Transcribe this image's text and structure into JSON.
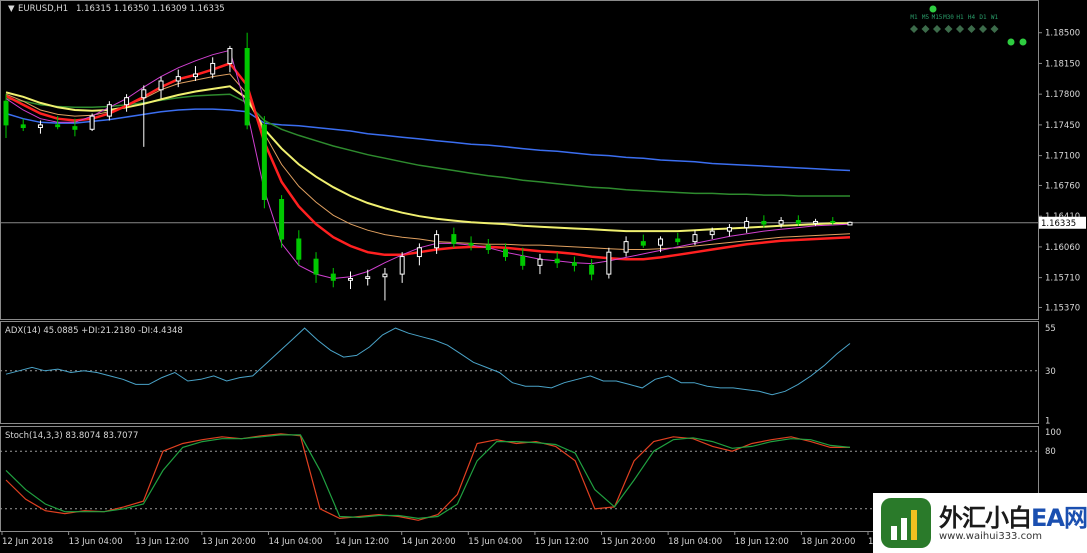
{
  "chart_data": [
    {
      "type": "candlestick",
      "symbol_header": "EURUSD,H1",
      "ohlc_header": "1.16315 1.16350 1.16309 1.16335",
      "current_price_label": "1.16335",
      "current_price": 1.16335,
      "ylim": [
        1.1525,
        1.1885
      ],
      "y_ticks": [
        "1.18500",
        "1.18150",
        "1.17800",
        "1.17450",
        "1.17100",
        "1.16760",
        "1.16410",
        "1.16060",
        "1.15710",
        "1.15370"
      ],
      "y_tick_values": [
        1.185,
        1.1815,
        1.178,
        1.1745,
        1.171,
        1.1676,
        1.1641,
        1.1606,
        1.1571,
        1.1537
      ],
      "x_labels": [
        "12 Jun 2018",
        "13 Jun 04:00",
        "13 Jun 12:00",
        "13 Jun 20:00",
        "14 Jun 04:00",
        "14 Jun 12:00",
        "14 Jun 20:00",
        "15 Jun 04:00",
        "15 Jun 12:00",
        "15 Jun 20:00",
        "18 Jun 04:00",
        "18 Jun 12:00",
        "18 Jun 20:00",
        "19 Jun 04:00"
      ],
      "timeframes": [
        "M1",
        "M5",
        "M15",
        "M30",
        "H1",
        "H4",
        "D1",
        "W1"
      ],
      "colors": {
        "up_candle": "#ffffff",
        "down_candle": "#00c800",
        "ma_blue": "#3b6ef0",
        "ma_green": "#2e8b2e",
        "ma_yellow": "#f0f070",
        "ma_orange": "#e0a060",
        "ma_red": "#ff2020",
        "ma_magenta": "#d040d0",
        "grid_line": "#888888"
      },
      "series": [
        {
          "values": [
            1.1758,
            1.1752,
            1.1748,
            1.1747,
            1.1747,
            1.1749,
            1.1751,
            1.1754,
            1.1757,
            1.176,
            1.1762,
            1.1763,
            1.1763,
            1.1762,
            1.176,
            1.1747,
            1.1745,
            1.1744,
            1.1742,
            1.174,
            1.1738,
            1.1735,
            1.1733,
            1.1731,
            1.1729,
            1.1727,
            1.1725,
            1.1723,
            1.1722,
            1.172,
            1.1718,
            1.1716,
            1.1715,
            1.1713,
            1.1711,
            1.171,
            1.1708,
            1.1707,
            1.1705,
            1.1704,
            1.1703,
            1.1701,
            1.17,
            1.1699,
            1.1698,
            1.1697,
            1.1696,
            1.1695,
            1.1694,
            1.1693
          ]
        },
        {
          "values": [
            1.1775,
            1.1772,
            1.1768,
            1.1766,
            1.1765,
            1.1765,
            1.1766,
            1.1768,
            1.177,
            1.1773,
            1.1776,
            1.1778,
            1.1779,
            1.178,
            1.177,
            1.175,
            1.174,
            1.1733,
            1.1727,
            1.1721,
            1.1716,
            1.1711,
            1.1707,
            1.1703,
            1.1699,
            1.1696,
            1.1693,
            1.169,
            1.1687,
            1.1685,
            1.1682,
            1.168,
            1.1678,
            1.1676,
            1.1674,
            1.1673,
            1.1671,
            1.167,
            1.1669,
            1.1668,
            1.1667,
            1.1667,
            1.1666,
            1.1666,
            1.1665,
            1.1665,
            1.1664,
            1.1664,
            1.1664,
            1.1664
          ]
        },
        {
          "values": [
            1.1782,
            1.1777,
            1.177,
            1.1765,
            1.1762,
            1.1761,
            1.1762,
            1.1765,
            1.1769,
            1.1774,
            1.1779,
            1.1783,
            1.1786,
            1.1789,
            1.1775,
            1.174,
            1.1718,
            1.17,
            1.1686,
            1.1674,
            1.1664,
            1.1656,
            1.165,
            1.1645,
            1.1641,
            1.1638,
            1.1636,
            1.1634,
            1.1633,
            1.1632,
            1.163,
            1.1629,
            1.1628,
            1.1627,
            1.1626,
            1.1625,
            1.1624,
            1.1624,
            1.1624,
            1.1624,
            1.1625,
            1.1626,
            1.1627,
            1.1628,
            1.1629,
            1.163,
            1.1631,
            1.1632,
            1.1633,
            1.1633
          ]
        },
        {
          "values": [
            1.178,
            1.1772,
            1.1762,
            1.1757,
            1.1755,
            1.1756,
            1.176,
            1.1767,
            1.1775,
            1.1785,
            1.1792,
            1.1796,
            1.18,
            1.1803,
            1.178,
            1.1735,
            1.17,
            1.1675,
            1.1657,
            1.1642,
            1.1632,
            1.1625,
            1.162,
            1.1617,
            1.1615,
            1.1612,
            1.1611,
            1.161,
            1.1609,
            1.1609,
            1.1608,
            1.1608,
            1.1607,
            1.1606,
            1.1605,
            1.1604,
            1.1603,
            1.1603,
            1.1604,
            1.1605,
            1.1607,
            1.1609,
            1.1611,
            1.1613,
            1.1615,
            1.1617,
            1.1618,
            1.1619,
            1.162,
            1.1621
          ]
        },
        {
          "values": [
            1.1778,
            1.1768,
            1.1758,
            1.1752,
            1.175,
            1.1752,
            1.1758,
            1.1767,
            1.1777,
            1.1788,
            1.1797,
            1.1802,
            1.1808,
            1.1815,
            1.179,
            1.1725,
            1.168,
            1.1652,
            1.1632,
            1.1617,
            1.1607,
            1.16,
            1.1597,
            1.1597,
            1.16,
            1.1603,
            1.1605,
            1.1606,
            1.1606,
            1.1605,
            1.1603,
            1.1601,
            1.16,
            1.1598,
            1.1595,
            1.1593,
            1.1592,
            1.1592,
            1.1594,
            1.1597,
            1.16,
            1.1603,
            1.1606,
            1.1609,
            1.1611,
            1.1613,
            1.1614,
            1.1615,
            1.1616,
            1.1617
          ]
        },
        {
          "values": [
            1.1775,
            1.1762,
            1.1752,
            1.1748,
            1.1748,
            1.1755,
            1.1765,
            1.1775,
            1.1788,
            1.18,
            1.181,
            1.1818,
            1.1825,
            1.183,
            1.176,
            1.167,
            1.161,
            1.1585,
            1.1575,
            1.157,
            1.1572,
            1.1578,
            1.1588,
            1.1597,
            1.1605,
            1.161,
            1.161,
            1.1608,
            1.1605,
            1.16,
            1.1596,
            1.1592,
            1.159,
            1.1588,
            1.1587,
            1.159,
            1.1594,
            1.1598,
            1.1602,
            1.1606,
            1.161,
            1.1614,
            1.1618,
            1.1621,
            1.1624,
            1.1626,
            1.1628,
            1.163,
            1.1631,
            1.1632
          ]
        }
      ],
      "candles": [
        {
          "o": 1.1772,
          "h": 1.178,
          "l": 1.173,
          "c": 1.1745
        },
        {
          "o": 1.1745,
          "h": 1.1752,
          "l": 1.1738,
          "c": 1.1742
        },
        {
          "o": 1.1742,
          "h": 1.175,
          "l": 1.1735,
          "c": 1.1745
        },
        {
          "o": 1.1745,
          "h": 1.1755,
          "l": 1.174,
          "c": 1.1743
        },
        {
          "o": 1.1743,
          "h": 1.1752,
          "l": 1.1732,
          "c": 1.174
        },
        {
          "o": 1.174,
          "h": 1.1758,
          "l": 1.1738,
          "c": 1.1755
        },
        {
          "o": 1.1755,
          "h": 1.1772,
          "l": 1.175,
          "c": 1.1768
        },
        {
          "o": 1.1768,
          "h": 1.178,
          "l": 1.176,
          "c": 1.1776
        },
        {
          "o": 1.1776,
          "h": 1.179,
          "l": 1.172,
          "c": 1.1785
        },
        {
          "o": 1.1785,
          "h": 1.18,
          "l": 1.1775,
          "c": 1.1795
        },
        {
          "o": 1.1795,
          "h": 1.1808,
          "l": 1.1788,
          "c": 1.18
        },
        {
          "o": 1.18,
          "h": 1.1812,
          "l": 1.1795,
          "c": 1.1803
        },
        {
          "o": 1.1803,
          "h": 1.1822,
          "l": 1.1798,
          "c": 1.1815
        },
        {
          "o": 1.1815,
          "h": 1.1835,
          "l": 1.1805,
          "c": 1.1832
        },
        {
          "o": 1.1832,
          "h": 1.185,
          "l": 1.174,
          "c": 1.1745
        },
        {
          "o": 1.1745,
          "h": 1.1755,
          "l": 1.165,
          "c": 1.166
        },
        {
          "o": 1.166,
          "h": 1.1665,
          "l": 1.1605,
          "c": 1.1615
        },
        {
          "o": 1.1615,
          "h": 1.1625,
          "l": 1.1585,
          "c": 1.1592
        },
        {
          "o": 1.1592,
          "h": 1.16,
          "l": 1.1565,
          "c": 1.1575
        },
        {
          "o": 1.1575,
          "h": 1.1582,
          "l": 1.156,
          "c": 1.1568
        },
        {
          "o": 1.1568,
          "h": 1.1578,
          "l": 1.1558,
          "c": 1.157
        },
        {
          "o": 1.157,
          "h": 1.158,
          "l": 1.1562,
          "c": 1.1572
        },
        {
          "o": 1.1572,
          "h": 1.1582,
          "l": 1.1545,
          "c": 1.1575
        },
        {
          "o": 1.1575,
          "h": 1.16,
          "l": 1.1565,
          "c": 1.1595
        },
        {
          "o": 1.1595,
          "h": 1.161,
          "l": 1.1585,
          "c": 1.1605
        },
        {
          "o": 1.1605,
          "h": 1.1625,
          "l": 1.1598,
          "c": 1.162
        },
        {
          "o": 1.162,
          "h": 1.1628,
          "l": 1.1605,
          "c": 1.161
        },
        {
          "o": 1.161,
          "h": 1.1618,
          "l": 1.1602,
          "c": 1.1608
        },
        {
          "o": 1.1608,
          "h": 1.1615,
          "l": 1.1598,
          "c": 1.1603
        },
        {
          "o": 1.1603,
          "h": 1.161,
          "l": 1.159,
          "c": 1.1595
        },
        {
          "o": 1.1595,
          "h": 1.1605,
          "l": 1.158,
          "c": 1.1585
        },
        {
          "o": 1.1585,
          "h": 1.1598,
          "l": 1.1575,
          "c": 1.1592
        },
        {
          "o": 1.1592,
          "h": 1.16,
          "l": 1.1582,
          "c": 1.1588
        },
        {
          "o": 1.1588,
          "h": 1.1595,
          "l": 1.1578,
          "c": 1.1585
        },
        {
          "o": 1.1585,
          "h": 1.1592,
          "l": 1.1568,
          "c": 1.1575
        },
        {
          "o": 1.1575,
          "h": 1.1605,
          "l": 1.157,
          "c": 1.16
        },
        {
          "o": 1.16,
          "h": 1.1618,
          "l": 1.1595,
          "c": 1.1612
        },
        {
          "o": 1.1612,
          "h": 1.162,
          "l": 1.1605,
          "c": 1.1608
        },
        {
          "o": 1.1608,
          "h": 1.1618,
          "l": 1.16,
          "c": 1.1615
        },
        {
          "o": 1.1615,
          "h": 1.1622,
          "l": 1.1608,
          "c": 1.1612
        },
        {
          "o": 1.1612,
          "h": 1.1625,
          "l": 1.1608,
          "c": 1.162
        },
        {
          "o": 1.162,
          "h": 1.1628,
          "l": 1.1615,
          "c": 1.1624
        },
        {
          "o": 1.1624,
          "h": 1.1632,
          "l": 1.1618,
          "c": 1.1628
        },
        {
          "o": 1.1628,
          "h": 1.164,
          "l": 1.1622,
          "c": 1.1635
        },
        {
          "o": 1.1635,
          "h": 1.1642,
          "l": 1.1628,
          "c": 1.1632
        },
        {
          "o": 1.1632,
          "h": 1.164,
          "l": 1.1628,
          "c": 1.1636
        },
        {
          "o": 1.1636,
          "h": 1.1642,
          "l": 1.163,
          "c": 1.1633
        },
        {
          "o": 1.1633,
          "h": 1.1638,
          "l": 1.163,
          "c": 1.1635
        },
        {
          "o": 1.1635,
          "h": 1.164,
          "l": 1.1631,
          "c": 1.1634
        },
        {
          "o": 1.1631,
          "h": 1.1635,
          "l": 1.1631,
          "c": 1.1634
        }
      ]
    },
    {
      "type": "line",
      "header": "ADX(14) 45.0885 +DI:21.2180 -DI:4.4348",
      "ylim": [
        0,
        58
      ],
      "y_ticks": [
        "55",
        "30",
        "1"
      ],
      "y_tick_values": [
        55,
        30,
        1
      ],
      "level": 30,
      "series": [
        {
          "values": [
            28,
            30,
            32,
            30,
            31,
            29,
            30,
            29,
            27,
            25,
            22,
            22,
            26,
            29,
            24,
            25,
            27,
            24,
            26,
            27,
            34,
            41,
            48,
            55,
            48,
            42,
            38,
            39,
            44,
            51,
            55,
            52,
            50,
            48,
            45,
            40,
            35,
            32,
            29,
            23,
            21,
            21,
            20,
            23,
            25,
            27,
            24,
            24,
            22,
            20,
            25,
            27,
            23,
            23,
            21,
            20,
            20,
            19,
            18,
            16,
            18,
            22,
            27,
            33,
            40,
            46
          ]
        }
      ]
    },
    {
      "type": "line",
      "header": "Stoch(14,3,3) 83.8074 83.7077",
      "ylim": [
        0,
        100
      ],
      "y_ticks": [
        "100",
        "80"
      ],
      "y_tick_values": [
        100,
        80
      ],
      "levels": [
        80,
        20
      ],
      "series": [
        {
          "values": [
            50,
            30,
            18,
            15,
            18,
            17,
            22,
            28,
            80,
            88,
            92,
            95,
            93,
            96,
            98,
            96,
            20,
            10,
            12,
            14,
            12,
            8,
            14,
            35,
            88,
            92,
            88,
            90,
            85,
            70,
            20,
            22,
            70,
            90,
            95,
            93,
            85,
            80,
            88,
            92,
            95,
            90,
            84,
            84
          ]
        },
        {
          "values": [
            60,
            40,
            25,
            17,
            17,
            17,
            20,
            25,
            60,
            84,
            90,
            93,
            93,
            95,
            97,
            97,
            60,
            12,
            11,
            13,
            13,
            10,
            12,
            25,
            70,
            90,
            90,
            89,
            87,
            78,
            40,
            22,
            50,
            80,
            92,
            94,
            90,
            83,
            85,
            90,
            93,
            92,
            86,
            84
          ]
        }
      ]
    }
  ],
  "watermark": {
    "text_main": "外汇小白",
    "text_accent": "EA网",
    "url": "www.waihui333.com"
  }
}
